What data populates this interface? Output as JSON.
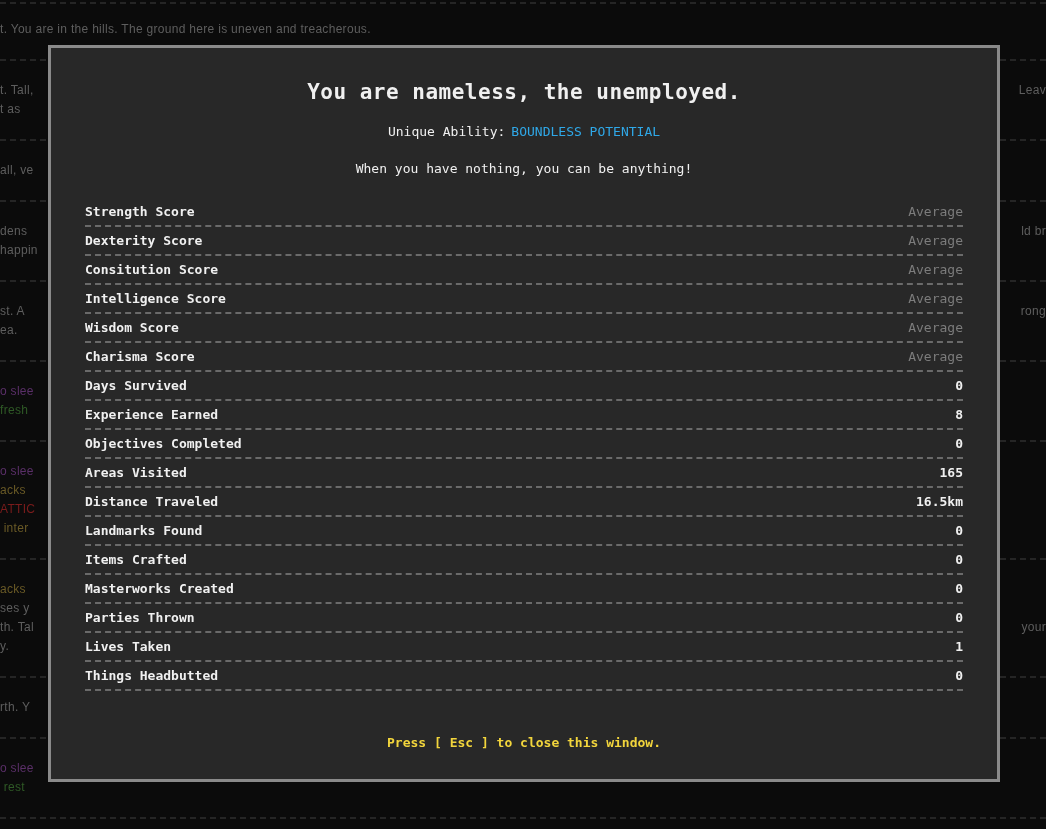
{
  "log": [
    {
      "lines": [
        {
          "left": "t. You are in the hills. The ground here is uneven and treacherous.",
          "color": "#5e5e5e"
        }
      ]
    },
    {
      "lines": [
        {
          "left": "t. Tall,",
          "right": "Leav",
          "color": "#5e5e5e"
        },
        {
          "left": "t as",
          "color": "#5e5e5e"
        }
      ]
    },
    {
      "lines": [
        {
          "left": "all, ve",
          "color": "#5e5e5e"
        }
      ]
    },
    {
      "lines": [
        {
          "left": "dens",
          "right": "ld br",
          "color": "#5e5e5e"
        },
        {
          "left": "happin",
          "color": "#5e5e5e"
        }
      ]
    },
    {
      "lines": [
        {
          "left": "st. A",
          "right": "rong",
          "color": "#5e5e5e"
        },
        {
          "left": "ea.",
          "color": "#5e5e5e"
        }
      ]
    },
    {
      "lines": [
        {
          "left": "o slee",
          "color": "#5a2f68"
        },
        {
          "left": "fresh",
          "color": "#2f5a26"
        }
      ]
    },
    {
      "lines": [
        {
          "left": "o slee",
          "color": "#5a2f68"
        },
        {
          "left": "acks",
          "color": "#6a5a26"
        },
        {
          "left": "ATTIC",
          "color": "#7a1c1c"
        },
        {
          "left": " inter",
          "color": "#6a5a26"
        }
      ]
    },
    {
      "lines": [
        {
          "left": "acks",
          "color": "#6a5a26"
        },
        {
          "left": "ses y",
          "color": "#5e5e5e"
        },
        {
          "left": "th. Tal",
          "right": "your",
          "color": "#5e5e5e"
        },
        {
          "left": "y.",
          "color": "#5e5e5e"
        }
      ]
    },
    {
      "lines": [
        {
          "left": "rth. Y",
          "color": "#5e5e5e"
        }
      ]
    },
    {
      "lines": [
        {
          "left": "o slee",
          "color": "#5a2f68"
        },
        {
          "left": " rest",
          "color": "#2f5a26"
        }
      ]
    }
  ],
  "dialog": {
    "title": "You are nameless, the unemployed.",
    "ability_label": "Unique Ability:",
    "ability_name": "BOUNDLESS POTENTIAL",
    "tagline": "When you have nothing, you can be anything!",
    "stats": [
      {
        "label": "Strength Score",
        "value": "Average",
        "kind": "rating"
      },
      {
        "label": "Dexterity Score",
        "value": "Average",
        "kind": "rating"
      },
      {
        "label": "Consitution Score",
        "value": "Average",
        "kind": "rating"
      },
      {
        "label": "Intelligence Score",
        "value": "Average",
        "kind": "rating"
      },
      {
        "label": "Wisdom Score",
        "value": "Average",
        "kind": "rating"
      },
      {
        "label": "Charisma Score",
        "value": "Average",
        "kind": "rating"
      },
      {
        "label": "Days Survived",
        "value": "0",
        "kind": "count"
      },
      {
        "label": "Experience Earned",
        "value": "8",
        "kind": "count"
      },
      {
        "label": "Objectives Completed",
        "value": "0",
        "kind": "count"
      },
      {
        "label": "Areas Visited",
        "value": "165",
        "kind": "count"
      },
      {
        "label": "Distance Traveled",
        "value": "16.5km",
        "kind": "count"
      },
      {
        "label": "Landmarks Found",
        "value": "0",
        "kind": "count"
      },
      {
        "label": "Items Crafted",
        "value": "0",
        "kind": "count"
      },
      {
        "label": "Masterworks Created",
        "value": "0",
        "kind": "count"
      },
      {
        "label": "Parties Thrown",
        "value": "0",
        "kind": "count"
      },
      {
        "label": "Lives Taken",
        "value": "1",
        "kind": "count"
      },
      {
        "label": "Things Headbutted",
        "value": "0",
        "kind": "count"
      }
    ],
    "footer": "Press [ Esc ] to close this window."
  }
}
